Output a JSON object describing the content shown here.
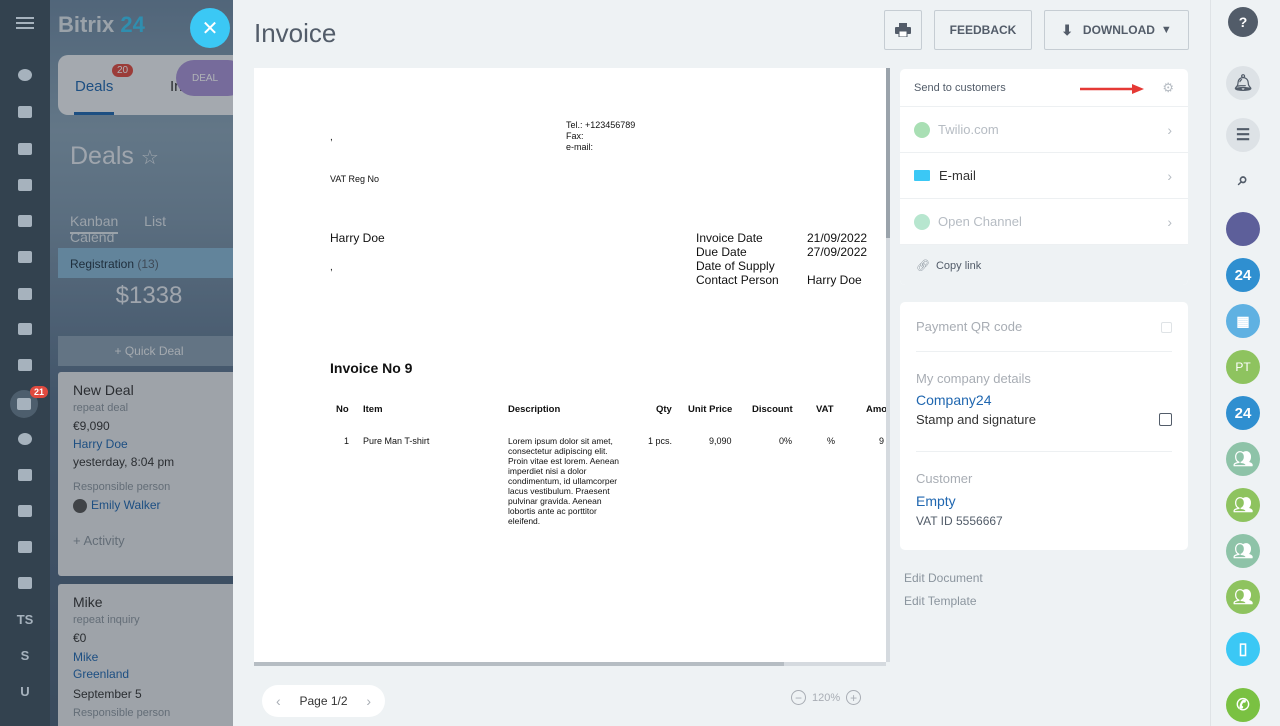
{
  "background_app": {
    "brand_name": "Bitrix",
    "brand_suffix": "24",
    "tab_deals": "Deals",
    "tab_deals_badge": "20",
    "tab_partial": "In",
    "deal_pill": "DEAL",
    "page_title": "Deals",
    "views": [
      "Kanban",
      "List",
      "Calend"
    ],
    "stage_name": "Registration",
    "stage_count": "(13)",
    "stage_sum": "$1338",
    "quick_deal": "+ Quick Deal",
    "cards": [
      {
        "title": "New Deal",
        "subtitle": "repeat deal",
        "amount": "€9,090",
        "contact": "Harry Doe",
        "time": "yesterday, 8:04 pm",
        "resp_label": "Responsible person",
        "resp": "Emily Walker",
        "activity": "+ Activity"
      },
      {
        "title": "Mike",
        "subtitle": "repeat inquiry",
        "amount": "€0",
        "contact": "Mike Greenland",
        "time": "September 5",
        "resp_label": "Responsible person"
      }
    ],
    "nav_badge": "21",
    "nav_letters": [
      "TS",
      "S",
      "U"
    ]
  },
  "invoice": {
    "title": "Invoice",
    "feedback": "FEEDBACK",
    "download": "DOWNLOAD",
    "doc": {
      "contact_lines": [
        "Tel.: +123456789",
        "Fax:",
        "e-mail:"
      ],
      "comma_1": ",",
      "vat_reg": "VAT Reg No",
      "client_name": "Harry Doe",
      "comma_2": ",",
      "meta": [
        {
          "label": "Invoice Date",
          "value": "21/09/2022"
        },
        {
          "label": "Due Date",
          "value": "27/09/2022"
        },
        {
          "label": "Date of Supply",
          "value": ""
        },
        {
          "label": "Contact Person",
          "value": "Harry Doe"
        }
      ],
      "invoice_no": "Invoice No 9",
      "columns": [
        "No",
        "Item",
        "Description",
        "Qty",
        "Unit Price",
        "Discount",
        "VAT",
        "Amo"
      ],
      "rows": [
        {
          "no": "1",
          "item": "Pure Man T-shirt",
          "description": "Lorem ipsum dolor sit amet, consectetur adipiscing elit. Proin vitae est lorem. Aenean imperdiet nisi a dolor condimentum, id ullamcorper lacus vestibulum. Praesent pulvinar gravida. Aenean lobortis ante ac porttitor eleifend.",
          "qty": "1 pcs.",
          "unit_price": "9,090",
          "discount": "0%",
          "vat": "%",
          "amount": "9"
        }
      ]
    },
    "pager": {
      "label": "Page 1/2"
    },
    "zoom": "120%"
  },
  "panel": {
    "send_title": "Send to customers",
    "channels": [
      {
        "label": "Twilio.com",
        "icon": "whatsapp-icon",
        "enabled": false
      },
      {
        "label": "E-mail",
        "icon": "mail-icon",
        "enabled": true
      },
      {
        "label": "Open Channel",
        "icon": "openchannel-icon",
        "enabled": false
      }
    ],
    "copy_link": "Copy link",
    "payment_qr": "Payment QR code",
    "company_details_label": "My company details",
    "company_name": "Company24",
    "stamp_label": "Stamp and signature",
    "customer_label": "Customer",
    "customer_value": "Empty",
    "vat_id": "VAT ID 5556667",
    "edit_document": "Edit Document",
    "edit_template": "Edit Template"
  },
  "right_bar": {
    "avatar_initials": "PT",
    "b24_label": "24"
  },
  "colors": {
    "accent": "#2067b0",
    "cyan": "#3bc8f5",
    "green_avatar": "#8ec35f",
    "arrow": "#e53935"
  }
}
